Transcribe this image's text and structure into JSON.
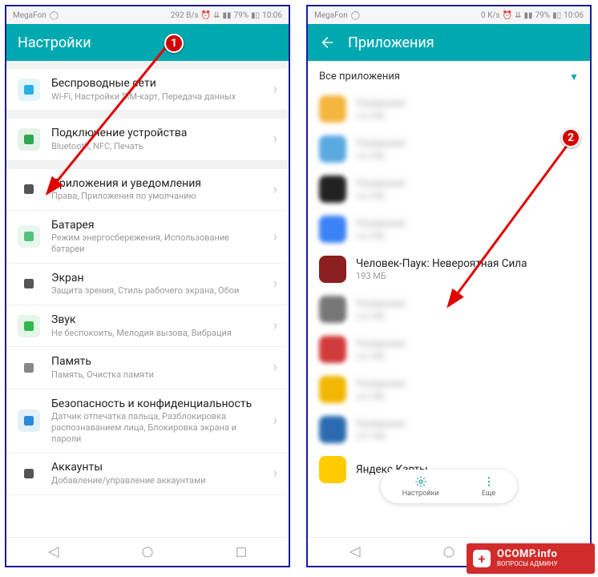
{
  "left": {
    "status": {
      "carrier": "MegaFon",
      "speed": "292 B/s",
      "battery": "79%",
      "time": "10:06"
    },
    "title": "Настройки",
    "items": [
      {
        "title": "Беспроводные сети",
        "sub": "Wi-Fi, Настройки SIM-карт, Передача данных",
        "iconColor": "#26b0e6"
      },
      {
        "title": "Подключение устройства",
        "sub": "Bluetooth, NFC, Печать",
        "iconColor": "#2fa84f"
      },
      {
        "title": "Приложения и уведомления",
        "sub": "Права, Приложения по умолчанию",
        "iconColor": "#555"
      },
      {
        "title": "Батарея",
        "sub": "Режим энергосбережения, Использование батареи",
        "iconColor": "#4fc37a"
      },
      {
        "title": "Экран",
        "sub": "Защита зрения, Стиль рабочего экрана, Обои",
        "iconColor": "#555"
      },
      {
        "title": "Звук",
        "sub": "Не беспокоить, Мелодия вызова, Вибрация",
        "iconColor": "#2fb84f"
      },
      {
        "title": "Память",
        "sub": "Память, Очистка памяти",
        "iconColor": "#888"
      },
      {
        "title": "Безопасность и конфиденциальность",
        "sub": "Датчик отпечатка пальца, Разблокировка распознаванием лица, Блокировка экрана и пароли",
        "iconColor": "#2a8cd6"
      },
      {
        "title": "Аккаунты",
        "sub": "Добавление/управление аккаунтами",
        "iconColor": "#555"
      }
    ]
  },
  "right": {
    "status": {
      "carrier": "MegaFon",
      "speed": "0 K/s",
      "battery": "79%",
      "time": "10:06"
    },
    "title": "Приложения",
    "filter": "Все приложения",
    "highlighted": {
      "title": "Человек-Паук: Невероятная Сила",
      "sub": "193 МБ"
    },
    "blurApps": [
      {
        "c": "#f4b63f"
      },
      {
        "c": "#5aa9e0"
      },
      {
        "c": "#222"
      },
      {
        "c": "#3b82f6"
      },
      {
        "c": "#777"
      },
      {
        "c": "#d23b3b"
      },
      {
        "c": "#f2b705"
      },
      {
        "c": "#2b6cb0",
        "sub": "231 МБ"
      }
    ],
    "lastVisible": "Яндекс.Карты",
    "float": {
      "left": "Настройки",
      "right": "Еще"
    }
  },
  "watermark": {
    "big": "OCOMP.info",
    "sm": "ВОПРОСЫ АДМИНУ"
  }
}
